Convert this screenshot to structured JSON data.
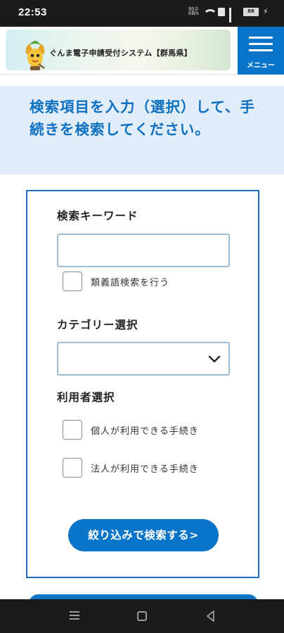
{
  "status_bar": {
    "time": "22:53",
    "net_speed_top": "93.0",
    "net_speed_bottom": "KB/s",
    "battery": "88"
  },
  "header": {
    "site_title": "ぐんま電子申請受付システム【群馬県】",
    "menu_label": "メニュー",
    "brand_color": "#0a74c8"
  },
  "intro": {
    "heading": "検索項目を入力（選択）して、手続きを検索してください。"
  },
  "search": {
    "keyword_label": "検索キーワード",
    "keyword_value": "",
    "synonym_label": "類義語検索を行う",
    "synonym_checked": false,
    "category_label": "カテゴリー選択",
    "category_value": "",
    "user_label": "利用者選択",
    "user_options": [
      {
        "label": "個人が利用できる手続き",
        "checked": false
      },
      {
        "label": "法人が利用できる手続き",
        "checked": false
      }
    ],
    "submit_label": "絞り込みで検索する>"
  },
  "nav_bar": {
    "icons": [
      "recents-icon",
      "home-icon",
      "back-icon"
    ]
  }
}
